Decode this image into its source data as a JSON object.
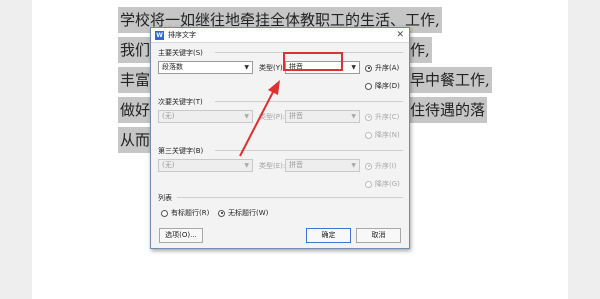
{
  "document": {
    "lines": [
      "学校将一如继往地牵挂全体教职工的生活、工作,",
      "我们",
      "丰富",
      "做好",
      "从而拉"
    ],
    "right_fragments": [
      "作,",
      "早中餐工作,",
      "住待遇的落"
    ]
  },
  "dialog": {
    "title": "排序文字",
    "close_glyph": "✕",
    "primary_key": {
      "label": "主要关键字(S)",
      "field_value": "段落数",
      "type_label": "类型(Y):",
      "type_value": "拼音",
      "ascending": "升序(A)",
      "descending": "降序(D)",
      "selected": "ascending"
    },
    "secondary_key": {
      "label": "次要关键字(T)",
      "field_value": "(无)",
      "type_label": "类型(P):",
      "type_value": "拼音",
      "ascending": "升序(C)",
      "descending": "降序(N)"
    },
    "tertiary_key": {
      "label": "第三关键字(B)",
      "field_value": "(无)",
      "type_label": "类型(E):",
      "type_value": "拼音",
      "ascending": "升序(I)",
      "descending": "降序(G)"
    },
    "list_section": {
      "label": "列表",
      "has_header": "有标题行(R)",
      "no_header": "无标题行(W)",
      "selected": "no_header"
    },
    "buttons": {
      "options": "选项(O)...",
      "ok": "确定",
      "cancel": "取消"
    }
  },
  "colors": {
    "highlight": "#e03030",
    "selection": "#c6c6c6",
    "dialog_border": "#6e8db6",
    "primary_button_border": "#3a78d6"
  }
}
